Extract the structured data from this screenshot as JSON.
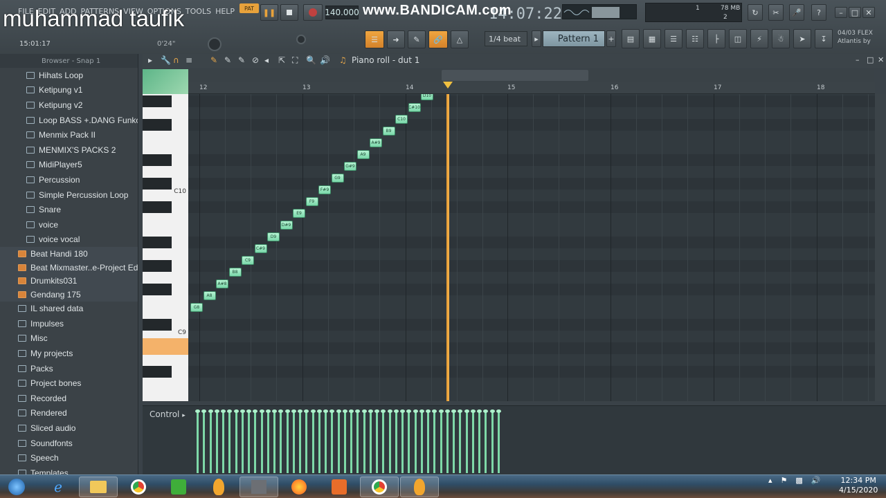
{
  "overlay_text": "muhammad taufik",
  "watermark": "www.BANDICAM.com",
  "menu": [
    "FILE",
    "EDIT",
    "ADD",
    "PATTERNS",
    "VIEW",
    "OPTIONS",
    "TOOLS",
    "HELP"
  ],
  "transport": {
    "pat_label": "PAT",
    "tempo": "140.000",
    "clock": "14:07:22",
    "song_time": "15:01:17",
    "hint_text": "0'24\""
  },
  "cpu": {
    "cpu_value": "1",
    "memory": "78 MB",
    "voices": "2"
  },
  "toolbar": {
    "snap": "1/4 beat",
    "pattern": "Pattern 1",
    "news_date": "04/03",
    "news_label": "FLEX",
    "news_text": "Atlantis by"
  },
  "browser": {
    "header": "Browser - Snap 1",
    "sub_items": [
      "Hihats Loop",
      "Ketipung v1",
      "Ketipung v2",
      "Loop BASS +.DANG Funkot",
      "Menmix Pack II",
      "MENMIX'S PACKS 2",
      "MidiPlayer5",
      "Percussion",
      "Simple Percussion Loop",
      "Snare",
      "voice",
      "voice vocal"
    ],
    "projects": [
      "Beat Handi 180",
      "Beat Mixmaster..e-Project Edit)",
      "Drumkits031",
      "Gendang 175"
    ],
    "folders": [
      "IL shared data",
      "Impulses",
      "Misc",
      "My projects",
      "Packs",
      "Project bones",
      "Recorded",
      "Rendered",
      "Sliced audio",
      "Soundfonts",
      "Speech",
      "Templates"
    ]
  },
  "piano_roll": {
    "title": "Piano roll - dut 1",
    "bars": [
      "12",
      "13",
      "14",
      "15",
      "16",
      "17",
      "18"
    ],
    "key_labels": [
      "C10",
      "C9"
    ],
    "control_label": "Control"
  },
  "notes": [
    "G8",
    "A8",
    "A#8",
    "B8",
    "C9",
    "C#9",
    "D9",
    "D#9",
    "E9",
    "F9",
    "F#9",
    "G9",
    "G#9",
    "A9",
    "A#9",
    "B9",
    "C10",
    "C#10",
    "D10",
    "D#10",
    "E10",
    "F10",
    "F#10",
    "G10"
  ],
  "taskbar": {
    "time": "12:34 PM",
    "date": "4/15/2020"
  },
  "colors": {
    "accent": "#e8a23b",
    "note": "#8ee0b6",
    "playhead": "#f0a63a"
  }
}
